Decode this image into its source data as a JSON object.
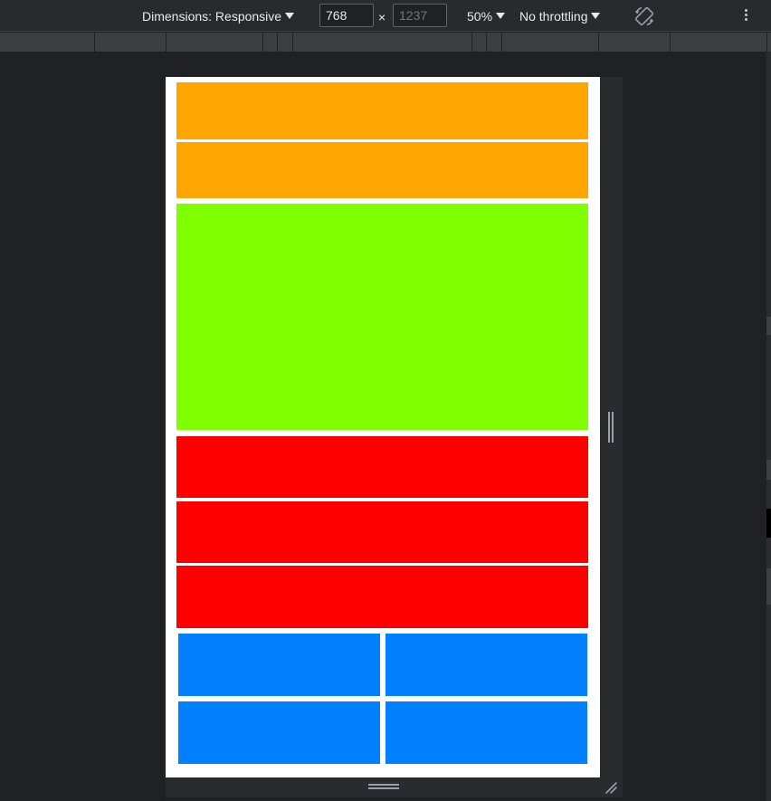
{
  "toolbar": {
    "dimensions_label": "Dimensions: Responsive",
    "width_value": "768",
    "height_placeholder": "1237",
    "times_symbol": "×",
    "zoom_label": "50%",
    "throttling_label": "No throttling",
    "rotate_icon": "rotate-device-icon",
    "more_icon": "more-vertical-icon"
  },
  "viewport": {
    "background": "#ffffff",
    "blocks": [
      {
        "name": "orange-block-1",
        "color": "#ffa500"
      },
      {
        "name": "orange-block-2",
        "color": "#ffa500"
      },
      {
        "name": "green-block",
        "color": "#7fff00"
      },
      {
        "name": "red-block-1",
        "color": "#ff0000"
      },
      {
        "name": "red-block-2",
        "color": "#ff0000"
      },
      {
        "name": "red-block-3",
        "color": "#ff0000"
      },
      {
        "name": "blue-block-1",
        "color": "#007fff"
      },
      {
        "name": "blue-block-2",
        "color": "#007fff"
      },
      {
        "name": "blue-block-3",
        "color": "#007fff"
      },
      {
        "name": "blue-block-4",
        "color": "#007fff"
      }
    ]
  },
  "colors": {
    "devtools_background": "#202124",
    "toolbar_background": "#292a2d",
    "ruler_background": "#3c3d40",
    "text": "#e8eaed"
  }
}
